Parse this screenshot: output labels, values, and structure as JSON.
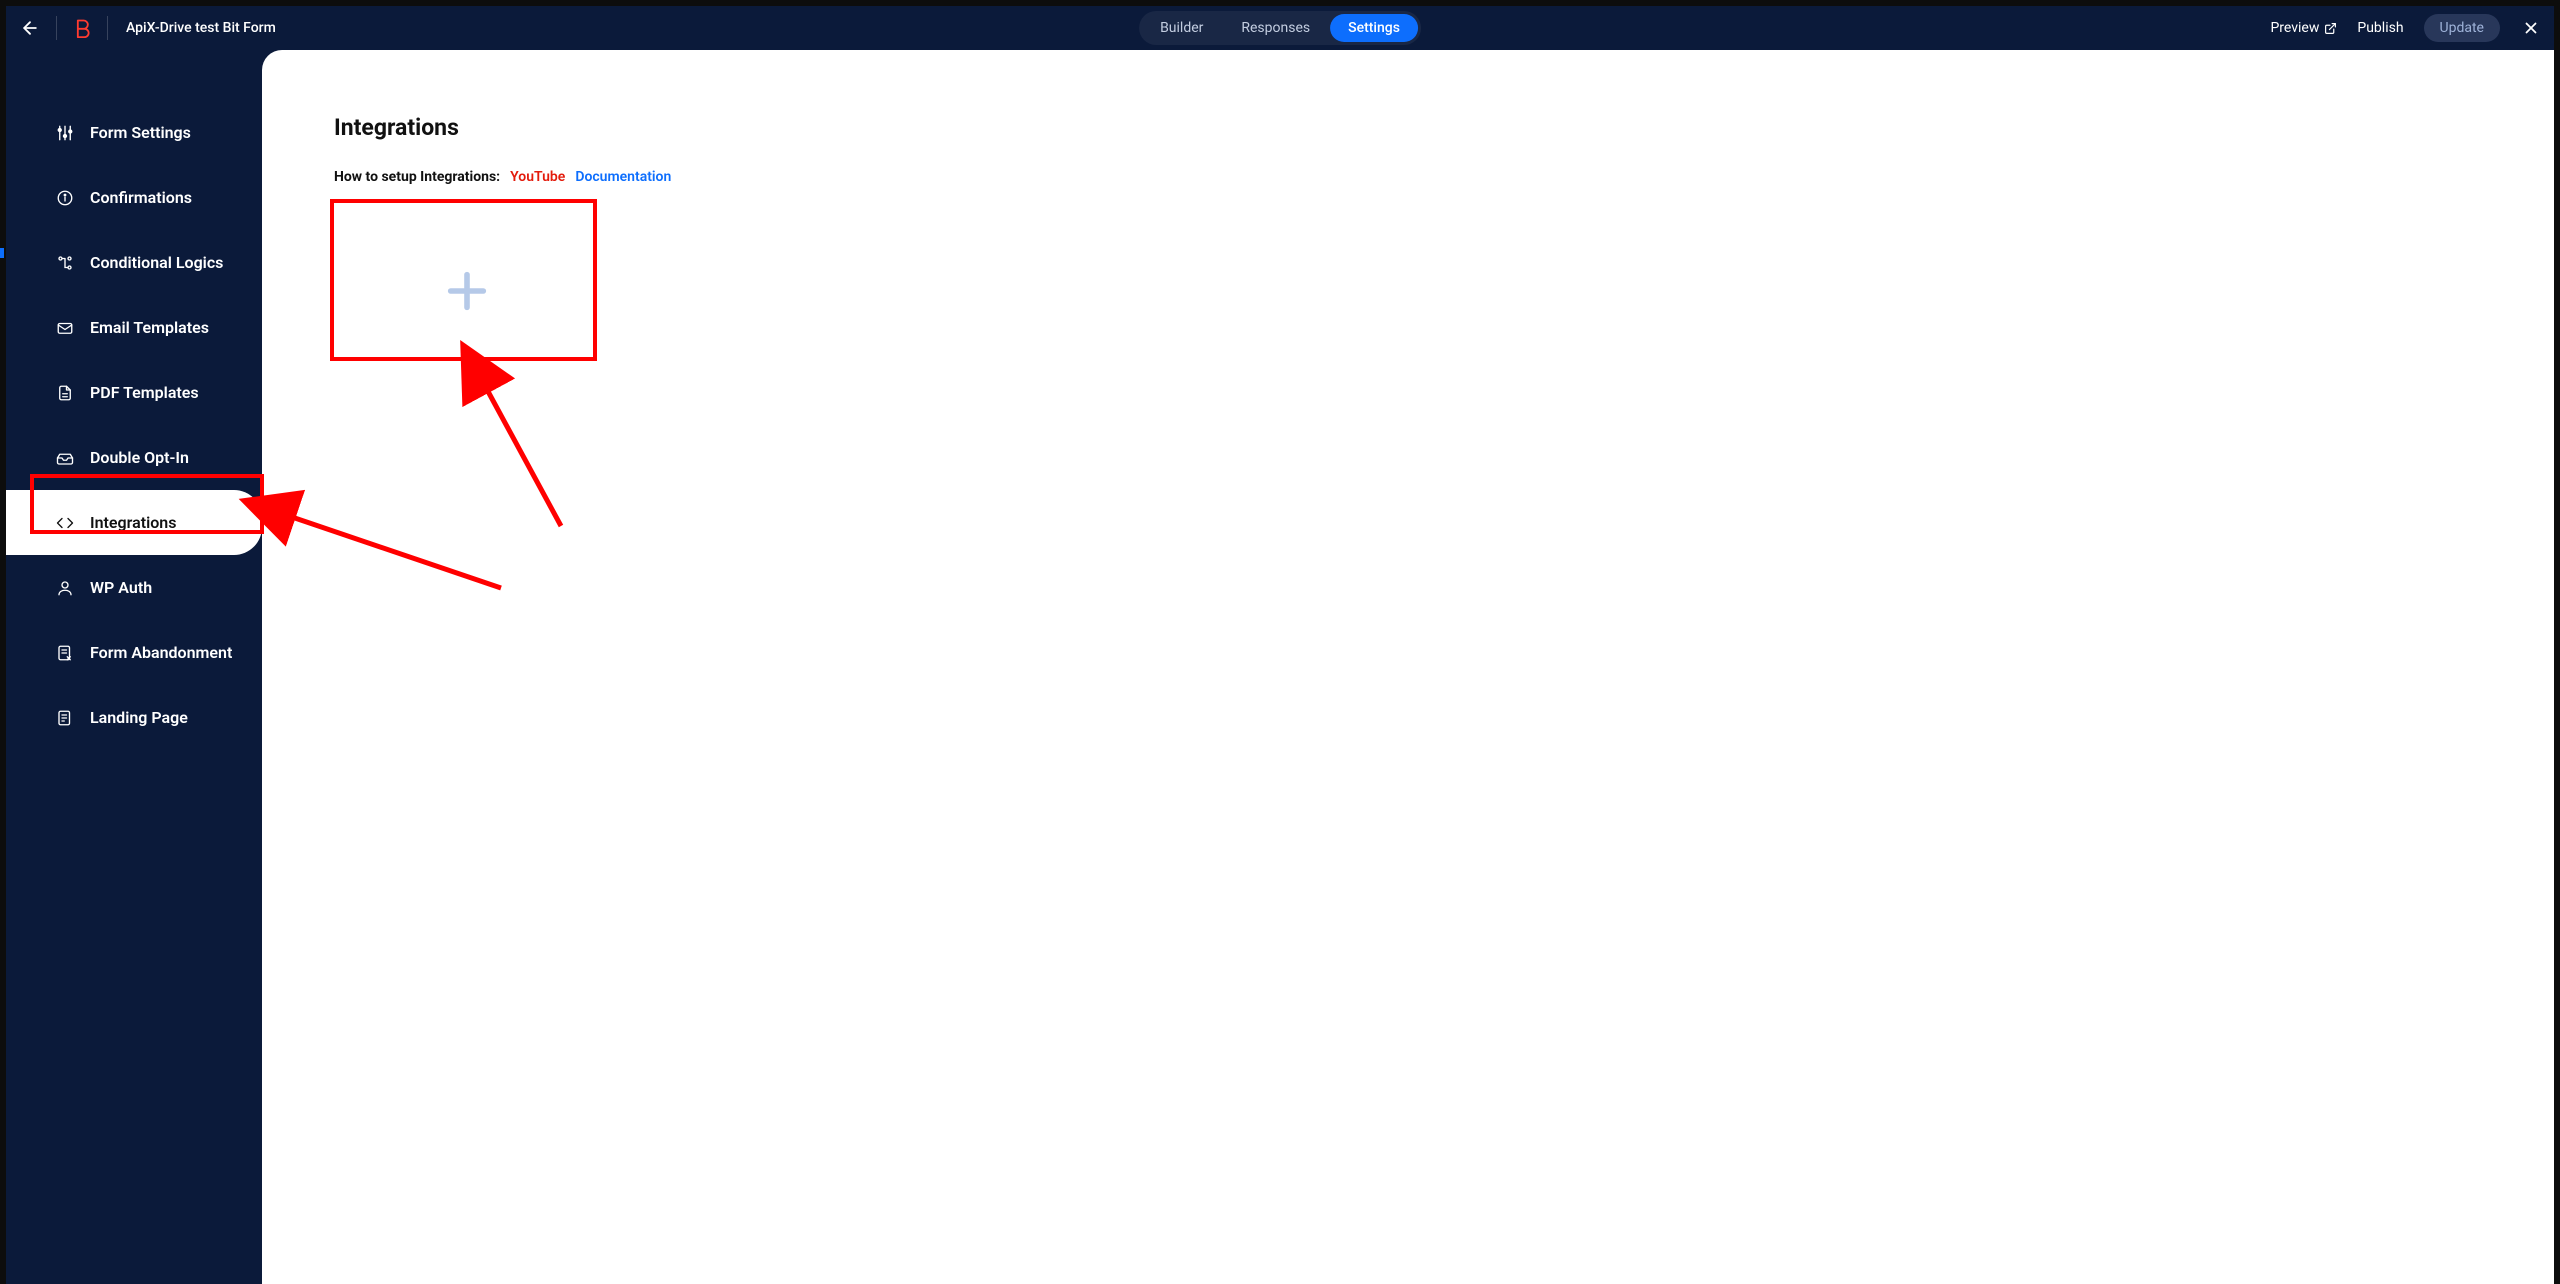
{
  "topbar": {
    "title": "ApiX-Drive test Bit Form",
    "tabs": {
      "builder": "Builder",
      "responses": "Responses",
      "settings": "Settings"
    },
    "preview": "Preview",
    "publish": "Publish",
    "update": "Update"
  },
  "sidebar": {
    "items": [
      {
        "id": "form-settings",
        "label": "Form Settings"
      },
      {
        "id": "confirmations",
        "label": "Confirmations"
      },
      {
        "id": "conditional-logics",
        "label": "Conditional Logics"
      },
      {
        "id": "email-templates",
        "label": "Email Templates"
      },
      {
        "id": "pdf-templates",
        "label": "PDF Templates"
      },
      {
        "id": "double-opt-in",
        "label": "Double Opt-In"
      },
      {
        "id": "integrations",
        "label": "Integrations"
      },
      {
        "id": "wp-auth",
        "label": "WP Auth"
      },
      {
        "id": "form-abandonment",
        "label": "Form Abandonment"
      },
      {
        "id": "landing-page",
        "label": "Landing Page"
      }
    ]
  },
  "content": {
    "heading": "Integrations",
    "help_prefix": "How to setup Integrations:",
    "youtube": "YouTube",
    "documentation": "Documentation"
  }
}
